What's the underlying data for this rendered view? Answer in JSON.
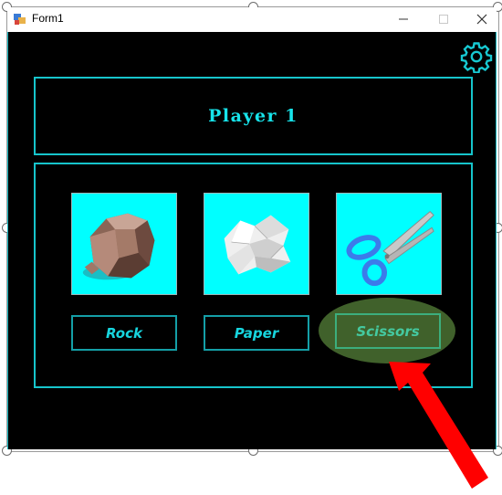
{
  "window": {
    "title": "Form1",
    "controls": {
      "minimize": "minimize-icon",
      "maximize": "maximize-icon",
      "close": "close-icon"
    }
  },
  "settings": {
    "icon": "gear-icon"
  },
  "header": {
    "player_label": "Player 1"
  },
  "choices": [
    {
      "label": "Rock",
      "image": "rock-image"
    },
    {
      "label": "Paper",
      "image": "crumpled-paper-image"
    },
    {
      "label": "Scissors",
      "image": "scissors-image"
    }
  ],
  "colors": {
    "accent": "#17e3ea",
    "card_background": "#00ffff",
    "form_background": "#000000",
    "highlight": "#43662d",
    "arrow": "#ff0000"
  }
}
